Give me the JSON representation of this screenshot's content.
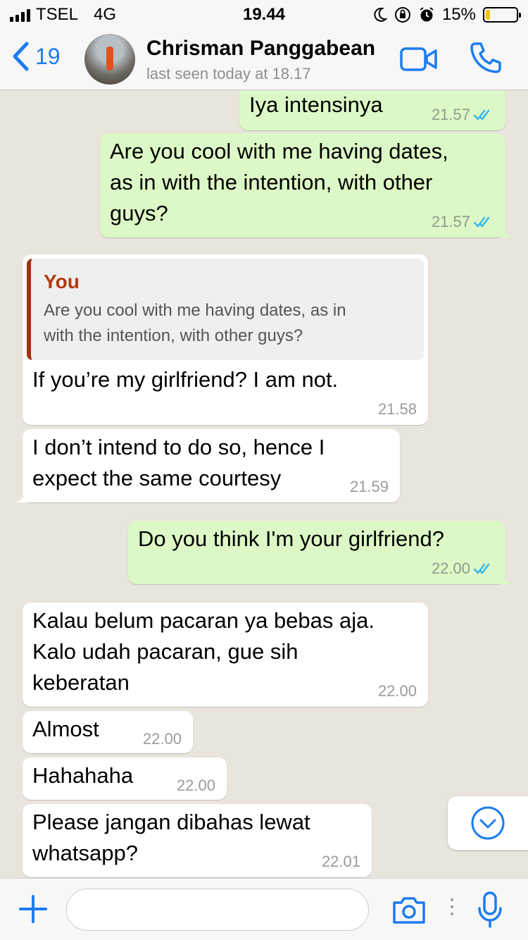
{
  "status_bar": {
    "carrier": "TSEL",
    "network": "4G",
    "time": "19.44",
    "battery": "15%",
    "battery_level": 0.15
  },
  "header": {
    "back_count": "19",
    "contact_name": "Chrisman Panggabean",
    "last_seen": "last seen today at 18.17"
  },
  "messages": [
    {
      "direction": "out",
      "text": "Iya intensinya",
      "time": "21.57",
      "read": true
    },
    {
      "direction": "out",
      "lines": [
        "Are you cool with me having dates,",
        "as in with the intention, with other",
        "guys?"
      ],
      "time": "21.57",
      "read": true
    },
    {
      "direction": "in",
      "quote": {
        "author": "You",
        "lines": [
          "Are you cool with me having dates, as in",
          "with the intention, with other guys?"
        ]
      },
      "text": "If you’re my girlfriend? I am not.",
      "time": "21.58"
    },
    {
      "direction": "in",
      "lines": [
        "I don’t intend to do so, hence I",
        "expect the same courtesy"
      ],
      "time": "21.59"
    },
    {
      "direction": "out",
      "text": "Do you think I'm your girlfriend?",
      "time": "22.00",
      "read": true
    },
    {
      "direction": "in",
      "lines": [
        "Kalau belum pacaran ya bebas aja.",
        "Kalo udah pacaran, gue sih",
        "keberatan"
      ],
      "time": "22.00"
    },
    {
      "direction": "in",
      "text": "Almost",
      "time": "22.00"
    },
    {
      "direction": "in",
      "text": "Hahahaha",
      "time": "22.00"
    },
    {
      "direction": "in",
      "lines": [
        "Please jangan dibahas lewat",
        "whatsapp?"
      ],
      "time": "22.01"
    }
  ],
  "input": {
    "value": "",
    "placeholder": ""
  },
  "colors": {
    "accent": "#1d7cf2",
    "outgoing_bubble": "#dcf8c6",
    "incoming_bubble": "#ffffff",
    "read_tick": "#34b7f1",
    "quote_bar": "#a2310f"
  },
  "icons": [
    "back-chevron-icon",
    "video-call-icon",
    "phone-call-icon",
    "double-tick-icon",
    "scroll-down-icon",
    "plus-icon",
    "camera-icon",
    "microphone-icon"
  ]
}
